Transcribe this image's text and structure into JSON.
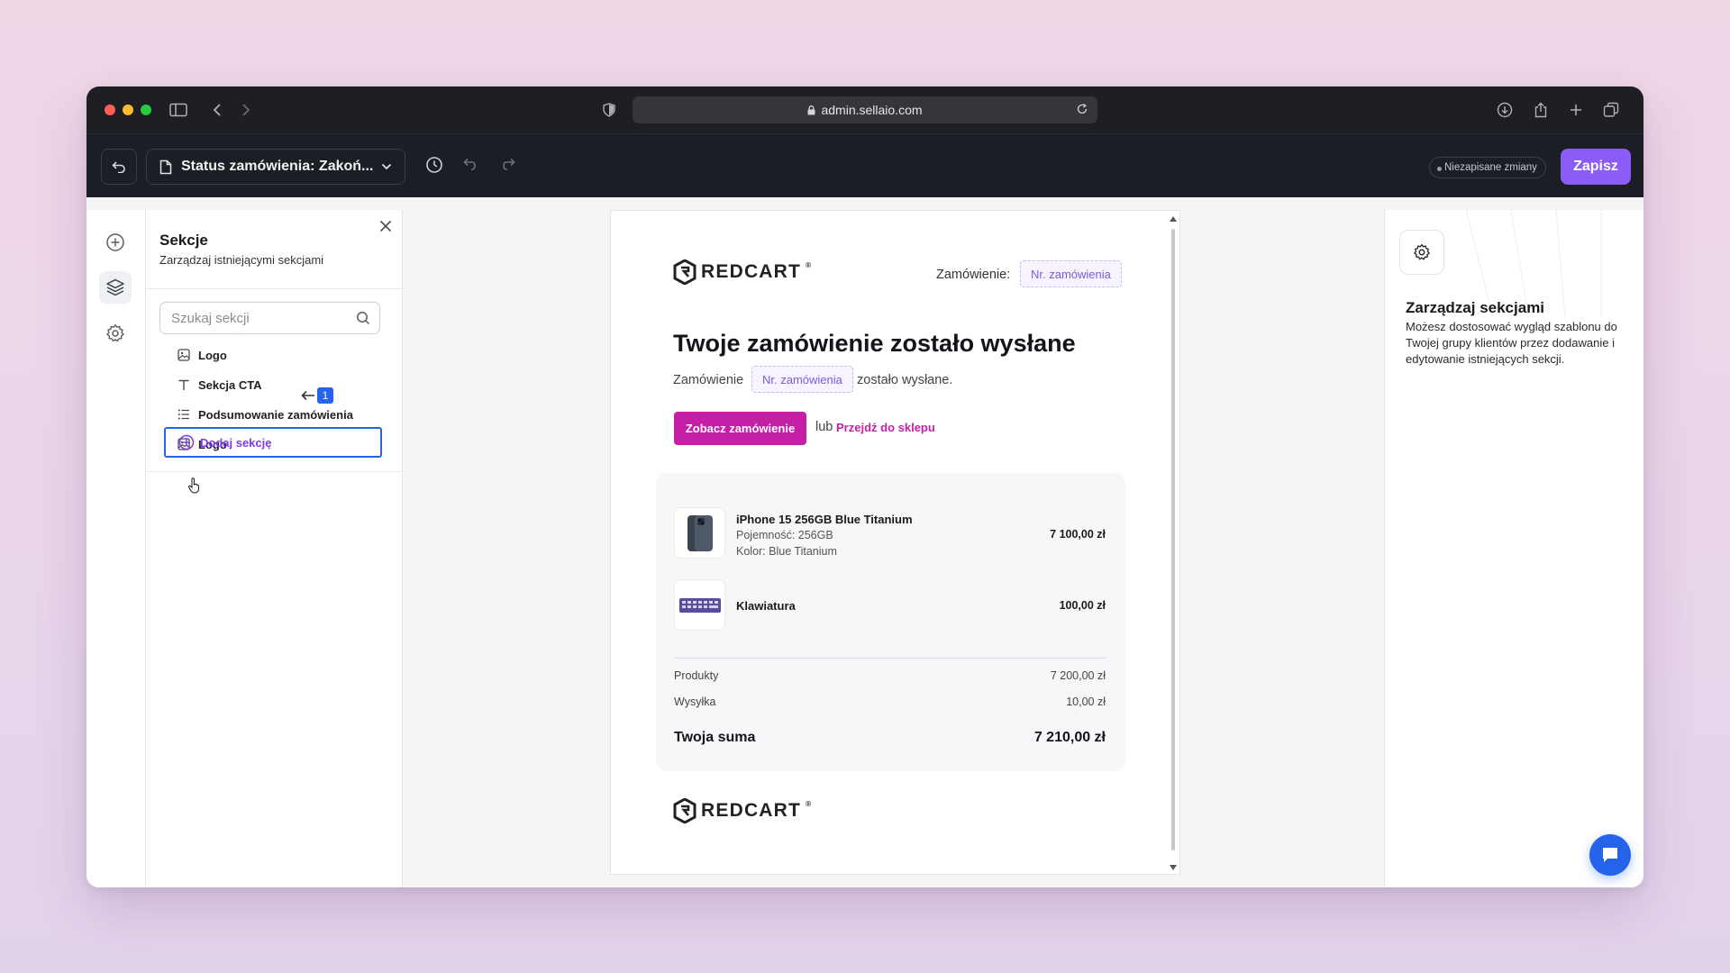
{
  "browser": {
    "url": "admin.sellaio.com"
  },
  "topbar": {
    "template_select": "Status zamówienia: Zakoń...",
    "unsaved_label": "Niezapisane zmiany",
    "save_label": "Zapisz"
  },
  "sections_panel": {
    "title": "Sekcje",
    "subtitle": "Zarządzaj istniejącymi sekcjami",
    "search_placeholder": "Szukaj sekcji",
    "items": [
      {
        "label": "Logo",
        "icon": "image-icon"
      },
      {
        "label": "Sekcja CTA",
        "icon": "text-icon"
      },
      {
        "label": "Podsumowanie zamówienia",
        "icon": "list-icon"
      },
      {
        "label": "Logo",
        "icon": "image-icon"
      }
    ],
    "add_label": "Dodaj sekcję",
    "annotation_badge": "1"
  },
  "email": {
    "logo_text": "REDCART",
    "logo_mark": "®",
    "order_label": "Zamówienie:",
    "order_placeholder": "Nr. zamówienia",
    "heading": "Twoje zamówienie zostało wysłane",
    "line_prefix": "Zamówienie",
    "line_placeholder": "Nr. zamówienia",
    "line_suffix": "zostało wysłane.",
    "cta_label": "Zobacz zamówienie",
    "or_text": "lub",
    "shop_link": "Przejdź do sklepu",
    "products": [
      {
        "name": "iPhone 15 256GB Blue Titanium",
        "meta1": "Pojemność: 256GB",
        "meta2": "Kolor: Blue Titanium",
        "price": "7 100,00 zł"
      },
      {
        "name": "Klawiatura",
        "price": "100,00 zł"
      }
    ],
    "products_label": "Produkty",
    "products_value": "7 200,00 zł",
    "shipping_label": "Wysyłka",
    "shipping_value": "10,00 zł",
    "total_label": "Twoja suma",
    "total_value": "7 210,00 zł",
    "footer_logo_text": "REDCART"
  },
  "right_panel": {
    "title": "Zarządzaj sekcjami",
    "description": "Możesz dostosować wygląd szablonu do Twojej grupy klientów przez dodawanie i edytowanie istniejących sekcji."
  },
  "colors": {
    "accent_purple": "#8b5cf6",
    "cta_magenta": "#c51fa8",
    "highlight_blue": "#2563eb"
  }
}
